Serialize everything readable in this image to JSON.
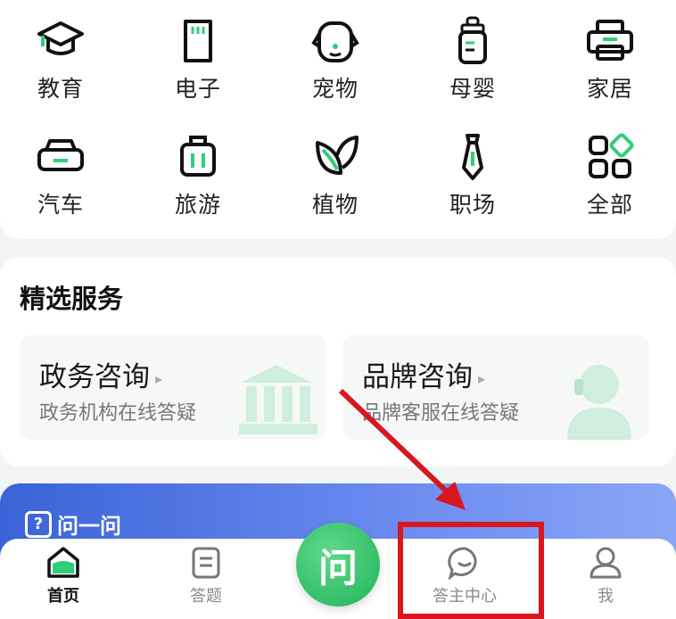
{
  "categories": {
    "row1": [
      "教育",
      "电子",
      "宠物",
      "母婴",
      "家居"
    ],
    "row2": [
      "汽车",
      "旅游",
      "植物",
      "职场",
      "全部"
    ]
  },
  "icons": {
    "row1": [
      "graduation-cap-icon",
      "sd-card-icon",
      "pet-face-icon",
      "baby-bottle-icon",
      "printer-icon"
    ],
    "row2": [
      "car-icon",
      "luggage-icon",
      "leaf-icon",
      "tie-icon",
      "grid-icon"
    ]
  },
  "services": {
    "title": "精选服务",
    "items": [
      {
        "name": "政务咨询",
        "desc": "政务机构在线答疑",
        "icon": "government-building-icon"
      },
      {
        "name": "品牌咨询",
        "desc": "品牌客服在线答疑",
        "icon": "customer-service-icon"
      }
    ]
  },
  "banner": {
    "logo_glyph": "?",
    "text": "问一问"
  },
  "tabbar": {
    "items": [
      {
        "label": "首页",
        "icon": "home-icon"
      },
      {
        "label": "答题",
        "icon": "document-icon"
      },
      {
        "label": "答主中心",
        "icon": "chat-bubble-icon"
      },
      {
        "label": "我",
        "icon": "user-icon"
      }
    ],
    "center_label": "问",
    "active_index": 0
  },
  "colors": {
    "accent": "#21b35a",
    "highlight": "#d8161f",
    "banner": "#3a63d8"
  }
}
